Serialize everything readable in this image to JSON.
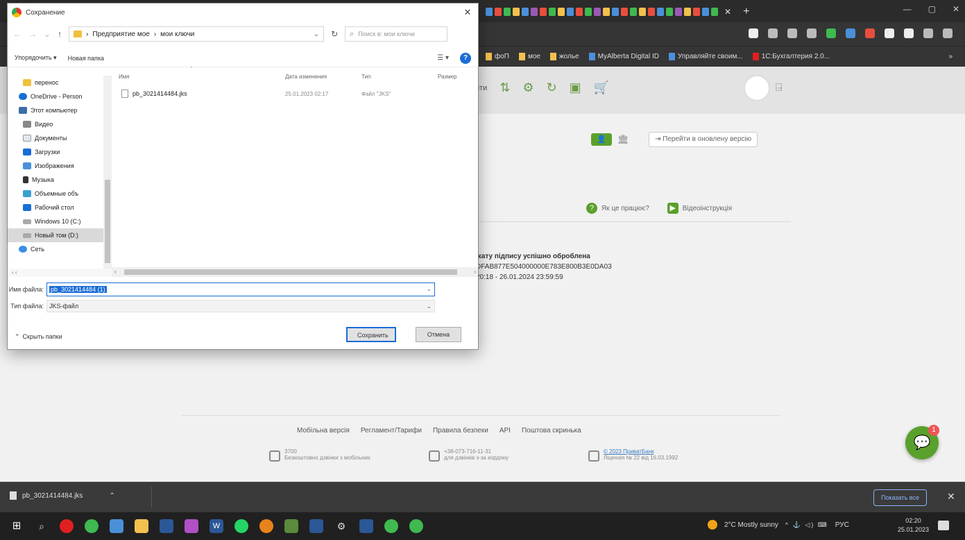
{
  "colors": {
    "accent": "#5aa02c",
    "dialog_selection": "#1a6dd6",
    "chrome_dark": "#2b2b2b"
  },
  "dialog": {
    "title": "Сохранение",
    "address": {
      "root": "Предприятие мое",
      "leaf": "мои ключи",
      "sep": "›",
      "chevron": "›"
    },
    "search_placeholder": "Поиск в: мои ключи",
    "toolbar": {
      "organize": "Упорядочить ▾",
      "new_folder": "Новая папка"
    },
    "nav_items": [
      {
        "label": "перенос",
        "icon": "folder-icon"
      },
      {
        "label": "OneDrive - Person",
        "icon": "onedrive-icon"
      },
      {
        "label": "Этот компьютер",
        "icon": "computer-icon"
      },
      {
        "label": "Видео",
        "icon": "video-icon"
      },
      {
        "label": "Документы",
        "icon": "documents-icon"
      },
      {
        "label": "Загрузки",
        "icon": "downloads-icon"
      },
      {
        "label": "Изображения",
        "icon": "images-icon"
      },
      {
        "label": "Музыка",
        "icon": "music-icon"
      },
      {
        "label": "Объемные объ",
        "icon": "3d-objects-icon"
      },
      {
        "label": "Рабочий стол",
        "icon": "desktop-icon"
      },
      {
        "label": "Windows 10 (C:)",
        "icon": "drive-icon"
      },
      {
        "label": "Новый том (D:)",
        "icon": "drive-icon"
      },
      {
        "label": "Сеть",
        "icon": "network-icon"
      }
    ],
    "columns": {
      "name": "Имя",
      "date": "Дата изменения",
      "type": "Тип",
      "size": "Размер"
    },
    "files": [
      {
        "name": "pb_3021414484.jks",
        "date": "25.01.2023 02:17",
        "type": "Файл \"JKS\""
      }
    ],
    "filename_label": "Имя файла:",
    "filename_value": "pb_3021414484 (1)",
    "filetype_label": "Тип файла:",
    "filetype_value": "JKS-файл",
    "hide_folders": "Скрыть папки",
    "save_label": "Сохранить",
    "cancel_label": "Отмена"
  },
  "bookmarks": [
    {
      "label": "фоП",
      "color": "yellow"
    },
    {
      "label": "мое",
      "color": "yellow"
    },
    {
      "label": "жолье",
      "color": "yellow"
    },
    {
      "label": "MyAlberta Digital ID",
      "color": "blue"
    },
    {
      "label": "Управляйте своим...",
      "color": "blue"
    },
    {
      "label": "1С:Бухгалтерия 2.0...",
      "color": "red"
    }
  ],
  "site": {
    "new_version": "Перейти в оновлену версію",
    "how_it_works": "Як це працює?",
    "video_instructions": "Відеоінструкція",
    "cert_line1": "ікату підпису успішно оброблена",
    "cert_line2": "DFAB877E504000000E783E800B3E0DA03",
    "cert_line3": "20:18 - 26.01.2024 23:59:59",
    "nav_cut_text": "ити",
    "footer_links": [
      "Мобільна версія",
      "Регламент/Тарифи",
      "Правила безпеки",
      "API",
      "Поштова скринька"
    ],
    "contacts": [
      {
        "top": "3700",
        "bottom": "Безкоштовно дзвінки з мобільних"
      },
      {
        "top": "+38-073-716-11-31",
        "bottom": "для дзвінків з-за кордону"
      },
      {
        "top": "© 2023 ПриватБанк",
        "bottom": "Ліцензія № 22 від 16.03.1992"
      }
    ],
    "chat_badge": "1"
  },
  "downloads": {
    "file": "pb_3021414484.jks",
    "show_all": "Показать все"
  },
  "taskbar": {
    "weather": "2°C  Mostly sunny",
    "lang": "РУС",
    "time": "02:20",
    "date": "25.01.2023"
  }
}
